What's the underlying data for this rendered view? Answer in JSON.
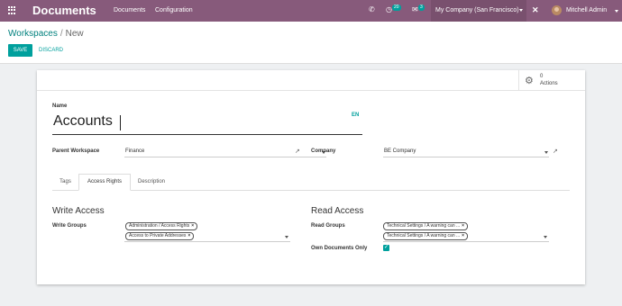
{
  "topbar": {
    "app_title": "Documents",
    "menu": [
      "Documents",
      "Configuration"
    ],
    "activity_count": "20",
    "message_count": "3",
    "company": "My Company (San Francisco)",
    "user": "Mitchell Admin"
  },
  "breadcrumb": {
    "parent": "Workspaces",
    "separator": "/",
    "current": "New"
  },
  "buttons": {
    "save": "SAVE",
    "discard": "DISCARD"
  },
  "stat_button": {
    "count": "0",
    "label": "Actions"
  },
  "form": {
    "name_label": "Name",
    "name_value": "Accounts",
    "lang": "EN",
    "parent_label": "Parent Workspace",
    "parent_value": "Finance",
    "company_label": "Company",
    "company_value": "BE Company"
  },
  "tabs": [
    "Tags",
    "Access Rights",
    "Description"
  ],
  "active_tab": "Access Rights",
  "write_access": {
    "title": "Write Access",
    "groups_label": "Write Groups",
    "tags": [
      "Administration / Access Rights",
      "Access to Private Addresses"
    ]
  },
  "read_access": {
    "title": "Read Access",
    "groups_label": "Read Groups",
    "tags": [
      "Technical Settings / A warning can ...",
      "Technical Settings / A warning can ..."
    ],
    "own_docs_label": "Own Documents Only",
    "own_docs_checked": true
  },
  "colors": {
    "brand": "#875a7b",
    "accent": "#00a09d"
  }
}
